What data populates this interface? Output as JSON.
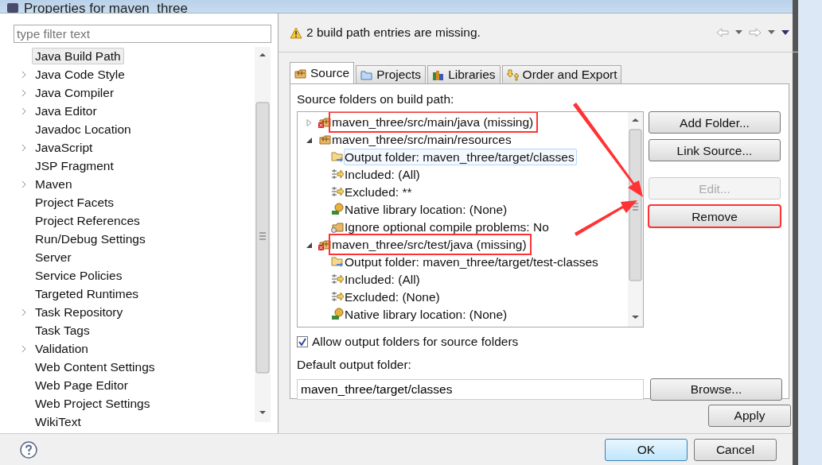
{
  "window": {
    "title": "Properties for maven_three"
  },
  "filter": {
    "placeholder": "type filter text"
  },
  "sidebar": {
    "items": [
      {
        "label": "Java Build Path",
        "expandable": false,
        "selected": true
      },
      {
        "label": "Java Code Style",
        "expandable": true,
        "selected": false
      },
      {
        "label": "Java Compiler",
        "expandable": true,
        "selected": false
      },
      {
        "label": "Java Editor",
        "expandable": true,
        "selected": false
      },
      {
        "label": "Javadoc Location",
        "expandable": false,
        "selected": false
      },
      {
        "label": "JavaScript",
        "expandable": true,
        "selected": false
      },
      {
        "label": "JSP Fragment",
        "expandable": false,
        "selected": false
      },
      {
        "label": "Maven",
        "expandable": true,
        "selected": false
      },
      {
        "label": "Project Facets",
        "expandable": false,
        "selected": false
      },
      {
        "label": "Project References",
        "expandable": false,
        "selected": false
      },
      {
        "label": "Run/Debug Settings",
        "expandable": false,
        "selected": false
      },
      {
        "label": "Server",
        "expandable": false,
        "selected": false
      },
      {
        "label": "Service Policies",
        "expandable": false,
        "selected": false
      },
      {
        "label": "Targeted Runtimes",
        "expandable": false,
        "selected": false
      },
      {
        "label": "Task Repository",
        "expandable": true,
        "selected": false
      },
      {
        "label": "Task Tags",
        "expandable": false,
        "selected": false
      },
      {
        "label": "Validation",
        "expandable": true,
        "selected": false
      },
      {
        "label": "Web Content Settings",
        "expandable": false,
        "selected": false
      },
      {
        "label": "Web Page Editor",
        "expandable": false,
        "selected": false
      },
      {
        "label": "Web Project Settings",
        "expandable": false,
        "selected": false
      },
      {
        "label": "WikiText",
        "expandable": false,
        "selected": false
      }
    ]
  },
  "message": {
    "text": "2 build path entries are missing."
  },
  "tabs": [
    {
      "label": "Source",
      "kind": "source",
      "selected": true
    },
    {
      "label": "Projects",
      "kind": "projects",
      "selected": false
    },
    {
      "label": "Libraries",
      "kind": "libraries",
      "selected": false
    },
    {
      "label": "Order and Export",
      "kind": "order",
      "selected": false
    }
  ],
  "source_label": "Source folders on build path:",
  "tree": [
    {
      "label": "maven_three/src/main/java (missing)",
      "kind": "source",
      "missing": true,
      "expanded": false,
      "highlighted": true,
      "selected": false
    },
    {
      "label": "maven_three/src/main/resources",
      "kind": "source",
      "missing": false,
      "expanded": true,
      "highlighted": false,
      "selected": false,
      "children": [
        {
          "label": "Output folder: maven_three/target/classes",
          "kind": "output",
          "selected": true
        },
        {
          "label": "Included: (All)",
          "kind": "filter",
          "selected": false
        },
        {
          "label": "Excluded: **",
          "kind": "filter",
          "selected": false
        },
        {
          "label": "Native library location: (None)",
          "kind": "native",
          "selected": false
        },
        {
          "label": "Ignore optional compile problems: No",
          "kind": "options",
          "selected": false
        }
      ]
    },
    {
      "label": "maven_three/src/test/java (missing)",
      "kind": "source",
      "missing": true,
      "expanded": true,
      "highlighted": true,
      "selected": false,
      "children": [
        {
          "label": "Output folder: maven_three/target/test-classes",
          "kind": "output",
          "selected": false
        },
        {
          "label": "Included: (All)",
          "kind": "filter",
          "selected": false
        },
        {
          "label": "Excluded: (None)",
          "kind": "filter",
          "selected": false
        },
        {
          "label": "Native library location: (None)",
          "kind": "native",
          "selected": false
        }
      ]
    }
  ],
  "side_buttons": [
    {
      "label": "Add Folder...",
      "disabled": false,
      "highlighted": false
    },
    {
      "label": "Link Source...",
      "disabled": false,
      "highlighted": false
    },
    {
      "label": "Edit...",
      "disabled": true,
      "highlighted": false
    },
    {
      "label": "Remove",
      "disabled": false,
      "highlighted": true
    }
  ],
  "allow_output": {
    "label": "Allow output folders for source folders",
    "checked": true
  },
  "default_output": {
    "label": "Default output folder:",
    "value": "maven_three/target/classes",
    "button": "Browse..."
  },
  "apply": "Apply",
  "dialog_buttons": [
    {
      "label": "OK",
      "default": true
    },
    {
      "label": "Cancel",
      "default": false
    }
  ]
}
